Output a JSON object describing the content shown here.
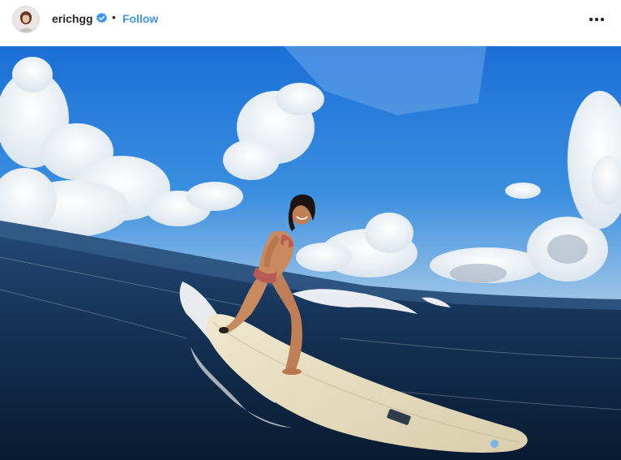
{
  "header": {
    "username": "erichgg",
    "separator": "•",
    "follow_label": "Follow",
    "verified_icon": "verified-badge-icon",
    "more_icon": "more-options-icon",
    "accent_color": "#3897f0"
  },
  "post": {
    "image_subject": "surfer-on-wave-photo"
  }
}
